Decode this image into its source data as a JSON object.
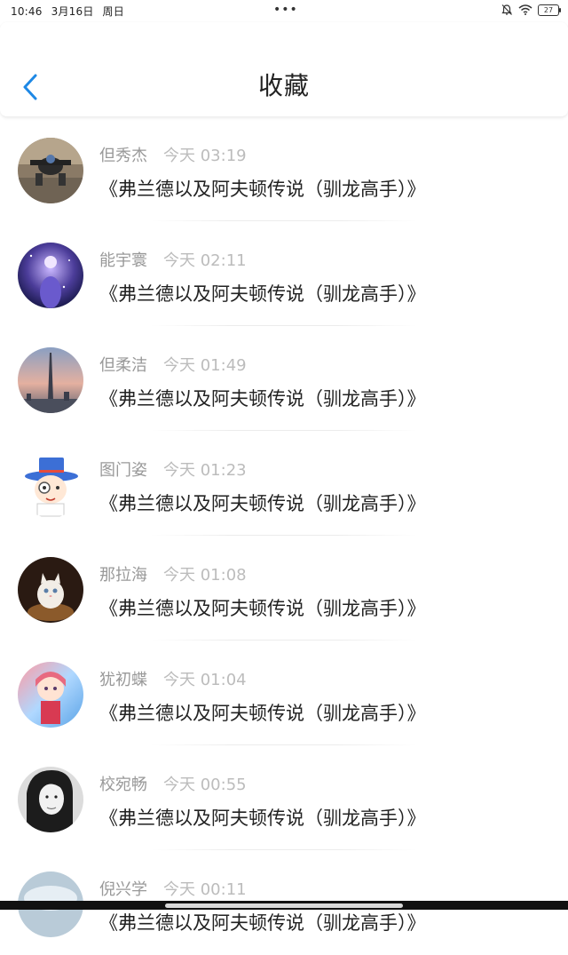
{
  "status_bar": {
    "time": "10:46",
    "date": "3月16日",
    "weekday": "周日",
    "battery": "27"
  },
  "header": {
    "title": "收藏"
  },
  "items": [
    {
      "name": "但秀杰",
      "time": "今天 03:19",
      "title": "《弗兰德以及阿夫顿传说（驯龙高手）》"
    },
    {
      "name": "能宇寰",
      "time": "今天 02:11",
      "title": "《弗兰德以及阿夫顿传说（驯龙高手）》"
    },
    {
      "name": "但柔洁",
      "time": "今天 01:49",
      "title": "《弗兰德以及阿夫顿传说（驯龙高手）》"
    },
    {
      "name": "图门姿",
      "time": "今天 01:23",
      "title": "《弗兰德以及阿夫顿传说（驯龙高手）》"
    },
    {
      "name": "那拉海",
      "time": "今天 01:08",
      "title": "《弗兰德以及阿夫顿传说（驯龙高手）》"
    },
    {
      "name": "犹初蝶",
      "time": "今天 01:04",
      "title": "《弗兰德以及阿夫顿传说（驯龙高手）》"
    },
    {
      "name": "校宛畅",
      "time": "今天 00:55",
      "title": "《弗兰德以及阿夫顿传说（驯龙高手）》"
    },
    {
      "name": "倪兴学",
      "time": "今天 00:11",
      "title": "《弗兰德以及阿夫顿传说（驯龙高手）》"
    }
  ],
  "colors": {
    "accent": "#1e88e5",
    "name_text": "#999999",
    "time_text": "#bcbcbc",
    "title_text": "#222222"
  },
  "icons": {
    "back": "chevron-left-icon",
    "mute": "bell-off-icon",
    "wifi": "wifi-icon",
    "battery": "battery-icon"
  }
}
